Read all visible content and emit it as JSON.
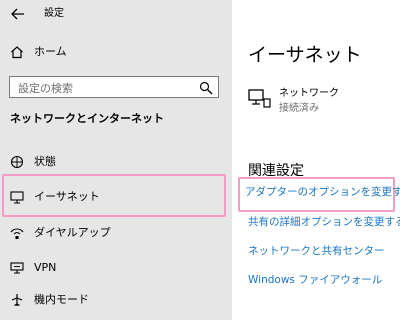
{
  "window": {
    "title": "設定"
  },
  "sidebar": {
    "home_label": "ホーム",
    "search_placeholder": "設定の検索",
    "section_title": "ネットワークとインターネット",
    "items": [
      {
        "label": "状態",
        "icon": "globe-icon"
      },
      {
        "label": "イーサネット",
        "icon": "monitor-icon",
        "selected": true
      },
      {
        "label": "ダイヤルアップ",
        "icon": "dialup-icon"
      },
      {
        "label": "VPN",
        "icon": "vpn-icon"
      },
      {
        "label": "機内モード",
        "icon": "airplane-icon"
      }
    ]
  },
  "main": {
    "title": "イーサネット",
    "network": {
      "name": "ネットワーク",
      "status": "接続済み"
    },
    "related_title": "関連設定",
    "links": [
      "アダプターのオプションを変更する",
      "共有の詳細オプションを変更する",
      "ネットワークと共有センター",
      "Windows ファイアウォール"
    ]
  },
  "colors": {
    "link": "#1a75c4",
    "highlight": "#f49bc7",
    "sidebar_bg": "#e6e6e6"
  }
}
